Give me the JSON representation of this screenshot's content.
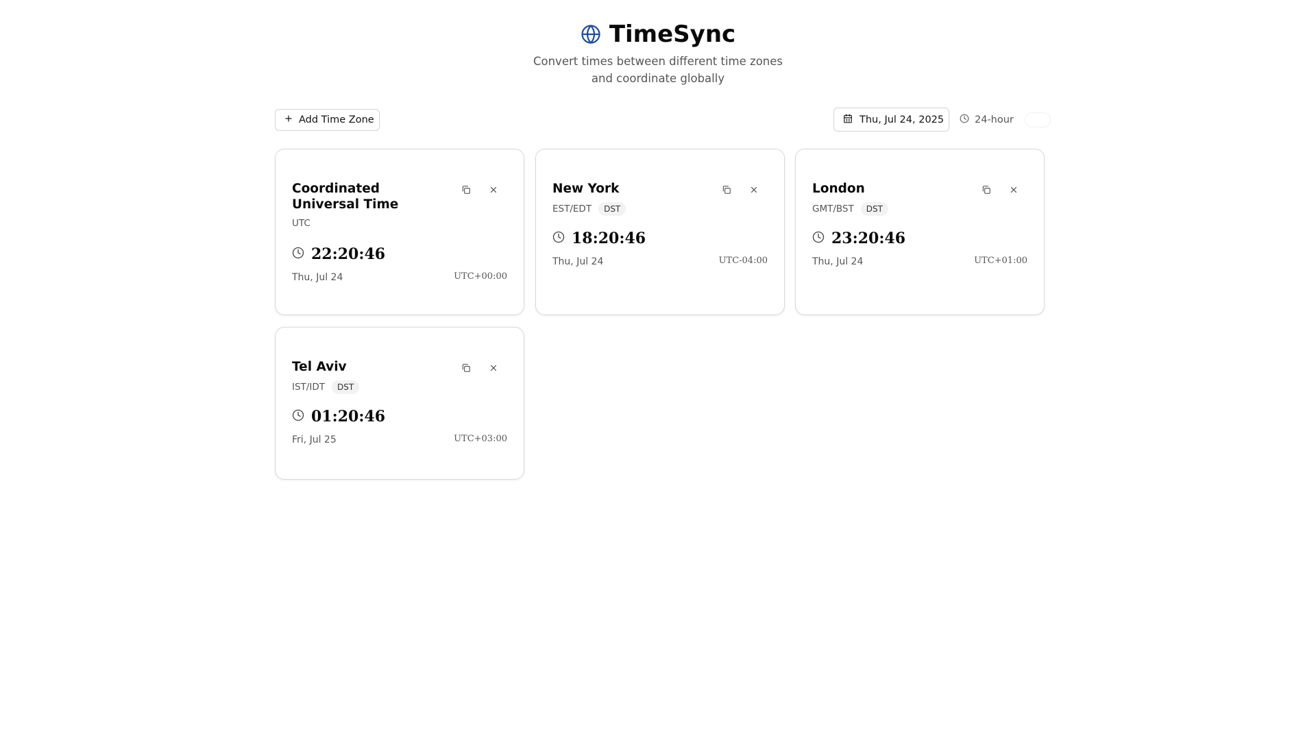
{
  "app": {
    "title": "TimeSync",
    "subtitle": "Convert times between different time zones and coordinate globally",
    "accent_color": "#1e4e9e",
    "logo_icon": "globe-icon"
  },
  "toolbar": {
    "add_label": "Add Time Zone",
    "date_label": "Thu, Jul 24, 2025",
    "format_label": "24-hour",
    "format_toggle_on": false
  },
  "cards": [
    {
      "name": "Coordinated Universal Time",
      "abbr": "UTC",
      "dst": "",
      "time": "22:20:46",
      "date": "Thu, Jul 24",
      "offset": "UTC+00:00"
    },
    {
      "name": "New York",
      "abbr": "EST/EDT",
      "dst": "DST",
      "time": "18:20:46",
      "date": "Thu, Jul 24",
      "offset": "UTC-04:00"
    },
    {
      "name": "London",
      "abbr": "GMT/BST",
      "dst": "DST",
      "time": "23:20:46",
      "date": "Thu, Jul 24",
      "offset": "UTC+01:00"
    },
    {
      "name": "Tel Aviv",
      "abbr": "IST/IDT",
      "dst": "DST",
      "time": "01:20:46",
      "date": "Fri, Jul 25",
      "offset": "UTC+03:00"
    }
  ]
}
